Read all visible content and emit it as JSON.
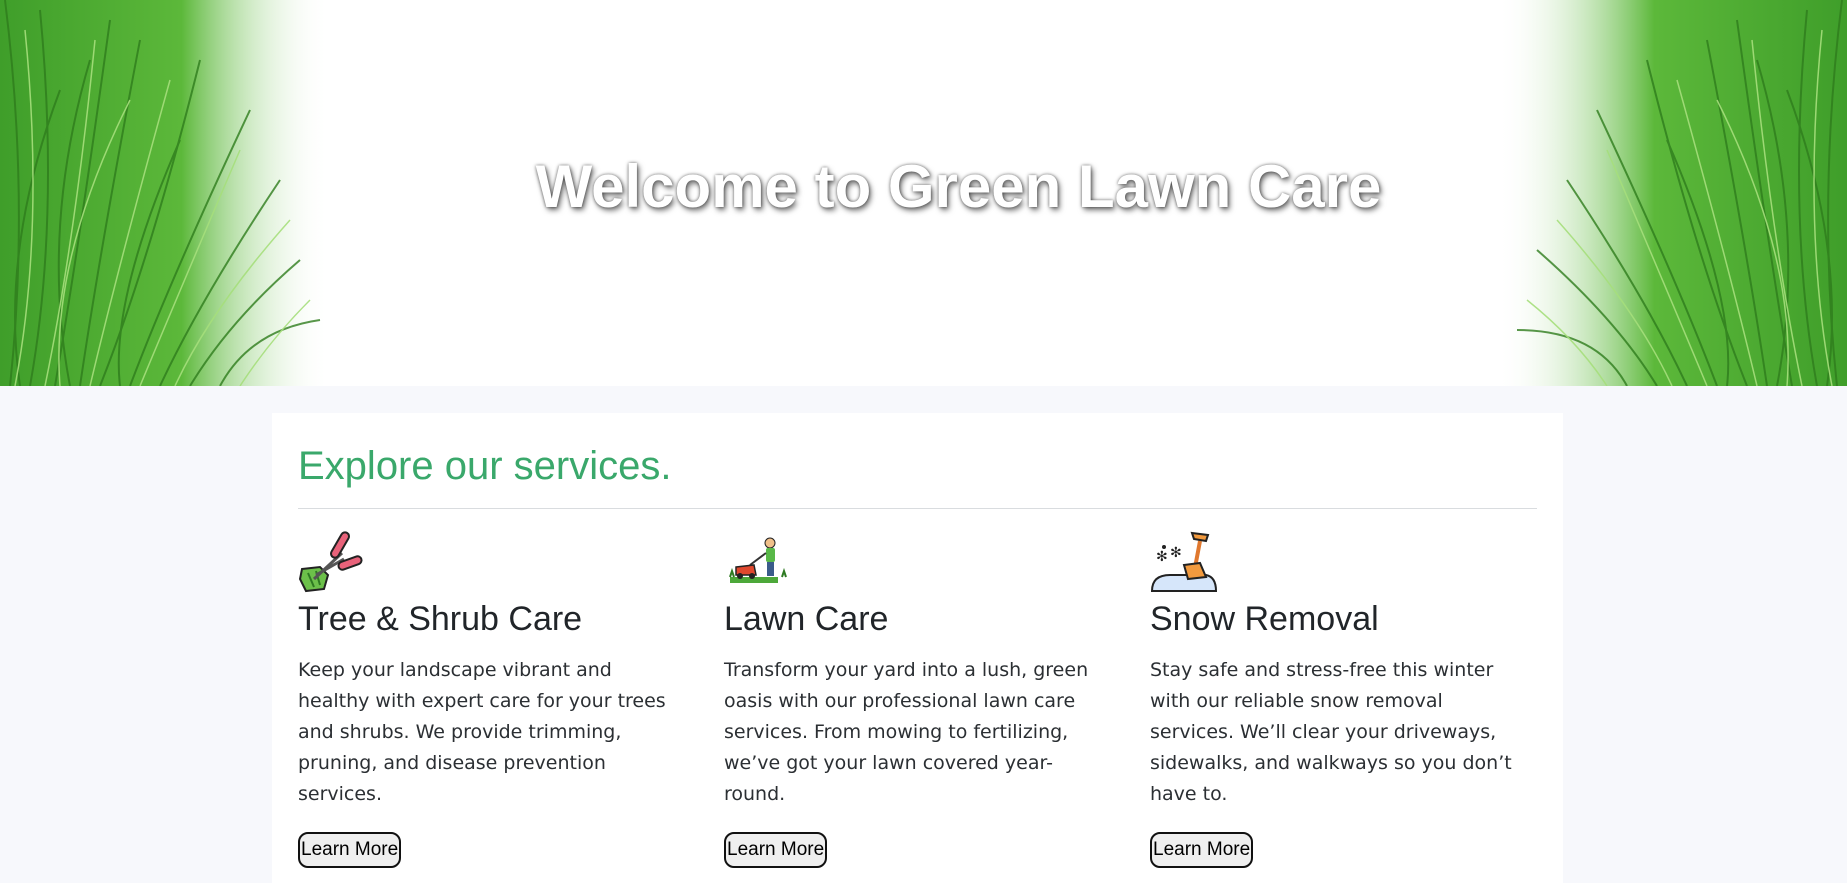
{
  "hero": {
    "title": "Welcome to Green Lawn Care"
  },
  "services": {
    "heading": "Explore our services.",
    "accent_color": "#3aa86b",
    "cards": [
      {
        "icon": "pruning-shears-icon",
        "title": "Tree & Shrub Care",
        "text": "Keep your landscape vibrant and healthy with expert care for your trees and shrubs. We provide trimming, pruning, and disease prevention services.",
        "button": "Learn More"
      },
      {
        "icon": "lawn-mower-icon",
        "title": "Lawn Care",
        "text": "Transform your yard into a lush, green oasis with our professional lawn care services. From mowing to fertilizing, we’ve got your lawn covered year-round.",
        "button": "Learn More"
      },
      {
        "icon": "snow-shovel-icon",
        "title": "Snow Removal",
        "text": "Stay safe and stress-free this winter with our reliable snow removal services. We’ll clear your driveways, sidewalks, and walkways so you don’t have to.",
        "button": "Learn More"
      }
    ]
  }
}
